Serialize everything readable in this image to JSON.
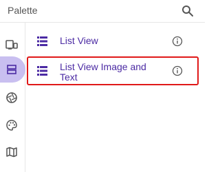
{
  "header": {
    "title": "Palette",
    "search_icon": "search-icon"
  },
  "rail": {
    "active_color": "#c9bff0",
    "items": [
      {
        "icon": "device-layout-icon"
      },
      {
        "icon": "list-layout-icon",
        "active": true
      },
      {
        "icon": "aperture-icon"
      },
      {
        "icon": "palette-icon"
      },
      {
        "icon": "map-icon"
      }
    ]
  },
  "list": {
    "items": [
      {
        "label": "List View",
        "icon": "list-view-icon",
        "info_icon": "info-icon"
      },
      {
        "label_line1": "List View Image and",
        "label_line2": "Text",
        "icon": "list-view-icon",
        "info_icon": "info-icon",
        "highlighted": true
      }
    ]
  },
  "colors": {
    "accent": "#4b2aa3",
    "highlight": "#e01818"
  }
}
